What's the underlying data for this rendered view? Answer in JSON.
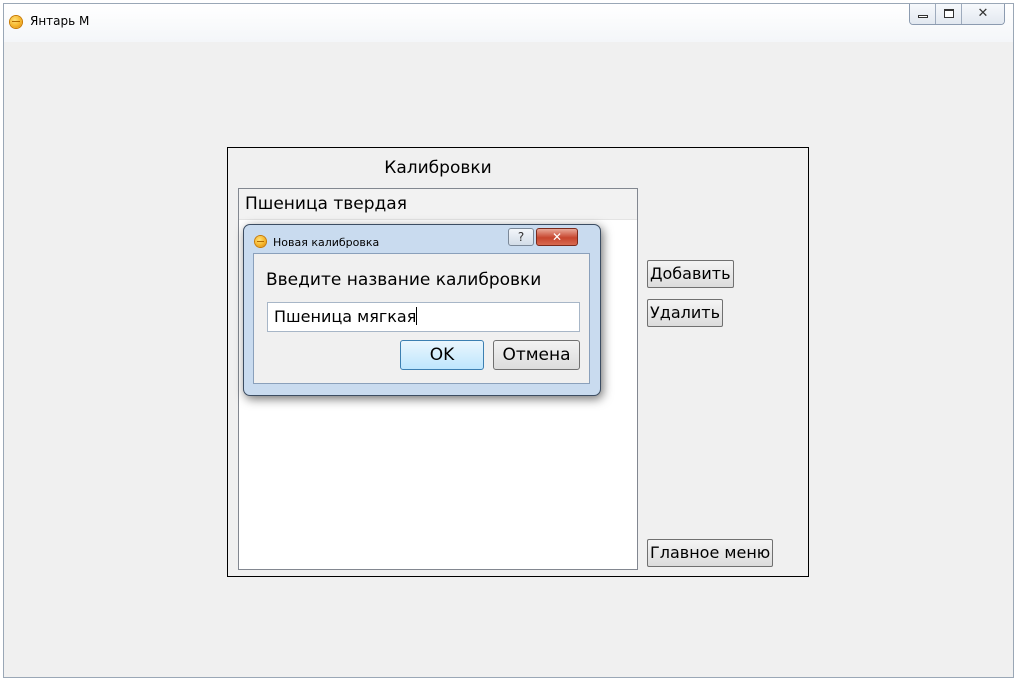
{
  "window": {
    "title": "Янтарь М",
    "close_glyph": "✕"
  },
  "panel": {
    "title": "Калибровки",
    "calibrations": [
      "Пшеница твердая"
    ],
    "buttons": {
      "add": "Добавить",
      "delete": "Удалить",
      "main_menu": "Главное меню"
    }
  },
  "dialog": {
    "title": "Новая калибровка",
    "help_glyph": "?",
    "close_glyph": "✕",
    "prompt": "Введите название калибровки",
    "input_value": "Пшеница мягкая",
    "ok_label": "OK",
    "cancel_label": "Отмена"
  },
  "colors": {
    "window_bg": "#f0f0f0",
    "dialog_frame": "#c9dbef",
    "ok_button": "#bee6fd",
    "close_button": "#c7452e"
  },
  "icons": [
    "app-icon",
    "minimize-icon",
    "maximize-icon",
    "close-icon",
    "help-icon"
  ]
}
